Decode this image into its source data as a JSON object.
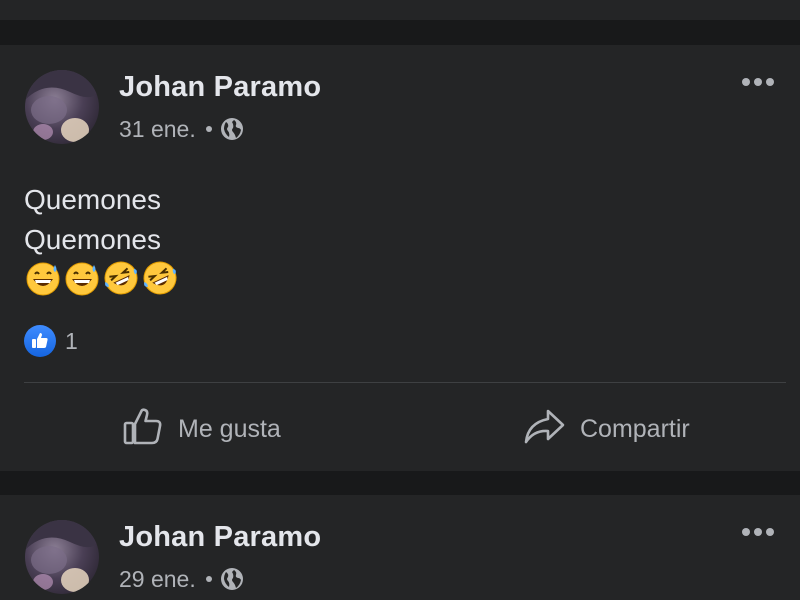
{
  "posts": [
    {
      "author": "Johan Paramo",
      "date": "31 ene.",
      "privacy_icon": "globe-icon",
      "text_lines": [
        "Quemones",
        "Quemones"
      ],
      "emojis": [
        "grinning-sweat-face",
        "grinning-sweat-face",
        "rolling-on-floor-laughing",
        "rolling-on-floor-laughing"
      ],
      "reaction_icon": "like-reaction-icon",
      "reaction_count": "1",
      "actions": {
        "like_label": "Me gusta",
        "share_label": "Compartir"
      }
    },
    {
      "author": "Johan Paramo",
      "date": "29 ene.",
      "privacy_icon": "globe-icon"
    }
  ],
  "colors": {
    "background": "#18191a",
    "card": "#242526",
    "primary_text": "#e4e6eb",
    "secondary_text": "#b0b3b8",
    "like_blue": "#1877f2"
  }
}
